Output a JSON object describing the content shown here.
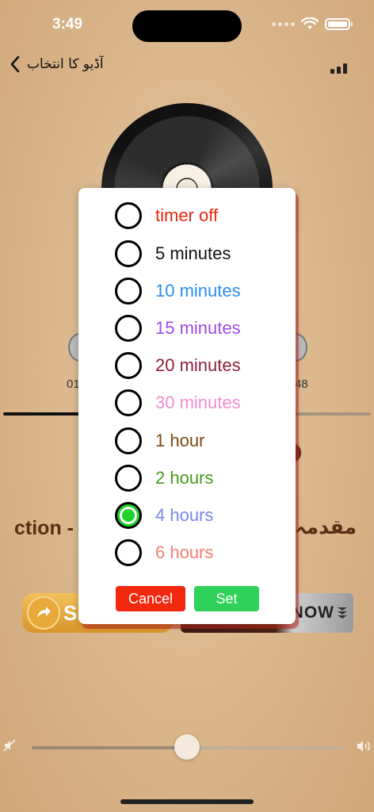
{
  "status_bar": {
    "time": "3:49"
  },
  "nav": {
    "title": "آڈیو کا انتخاب"
  },
  "player": {
    "time_left": "01",
    "time_right": "48",
    "progress": 0.22,
    "title_left": "ction -",
    "title_right": "مقدمہ",
    "share_letter": "S",
    "now_label": "NOW",
    "volume": 0.5
  },
  "dialog": {
    "options": [
      {
        "label": "timer off",
        "color": "#e8280f",
        "selected": false
      },
      {
        "label": "5 minutes",
        "color": "#111111",
        "selected": false
      },
      {
        "label": "10 minutes",
        "color": "#2a8fe8",
        "selected": false
      },
      {
        "label": "15 minutes",
        "color": "#a04ae8",
        "selected": false
      },
      {
        "label": "20 minutes",
        "color": "#8e1f3e",
        "selected": false
      },
      {
        "label": "30 minutes",
        "color": "#f08fd0",
        "selected": false
      },
      {
        "label": "1 hour",
        "color": "#7a4a12",
        "selected": false
      },
      {
        "label": "2 hours",
        "color": "#4a9a1e",
        "selected": false
      },
      {
        "label": "4 hours",
        "color": "#7b86ea",
        "selected": true
      },
      {
        "label": "6 hours",
        "color": "#f27d74",
        "selected": false
      }
    ],
    "cancel_label": "Cancel",
    "set_label": "Set",
    "colors": {
      "cancel": "#f2280f",
      "set": "#2fd15a",
      "shadow": "#b42819"
    }
  }
}
